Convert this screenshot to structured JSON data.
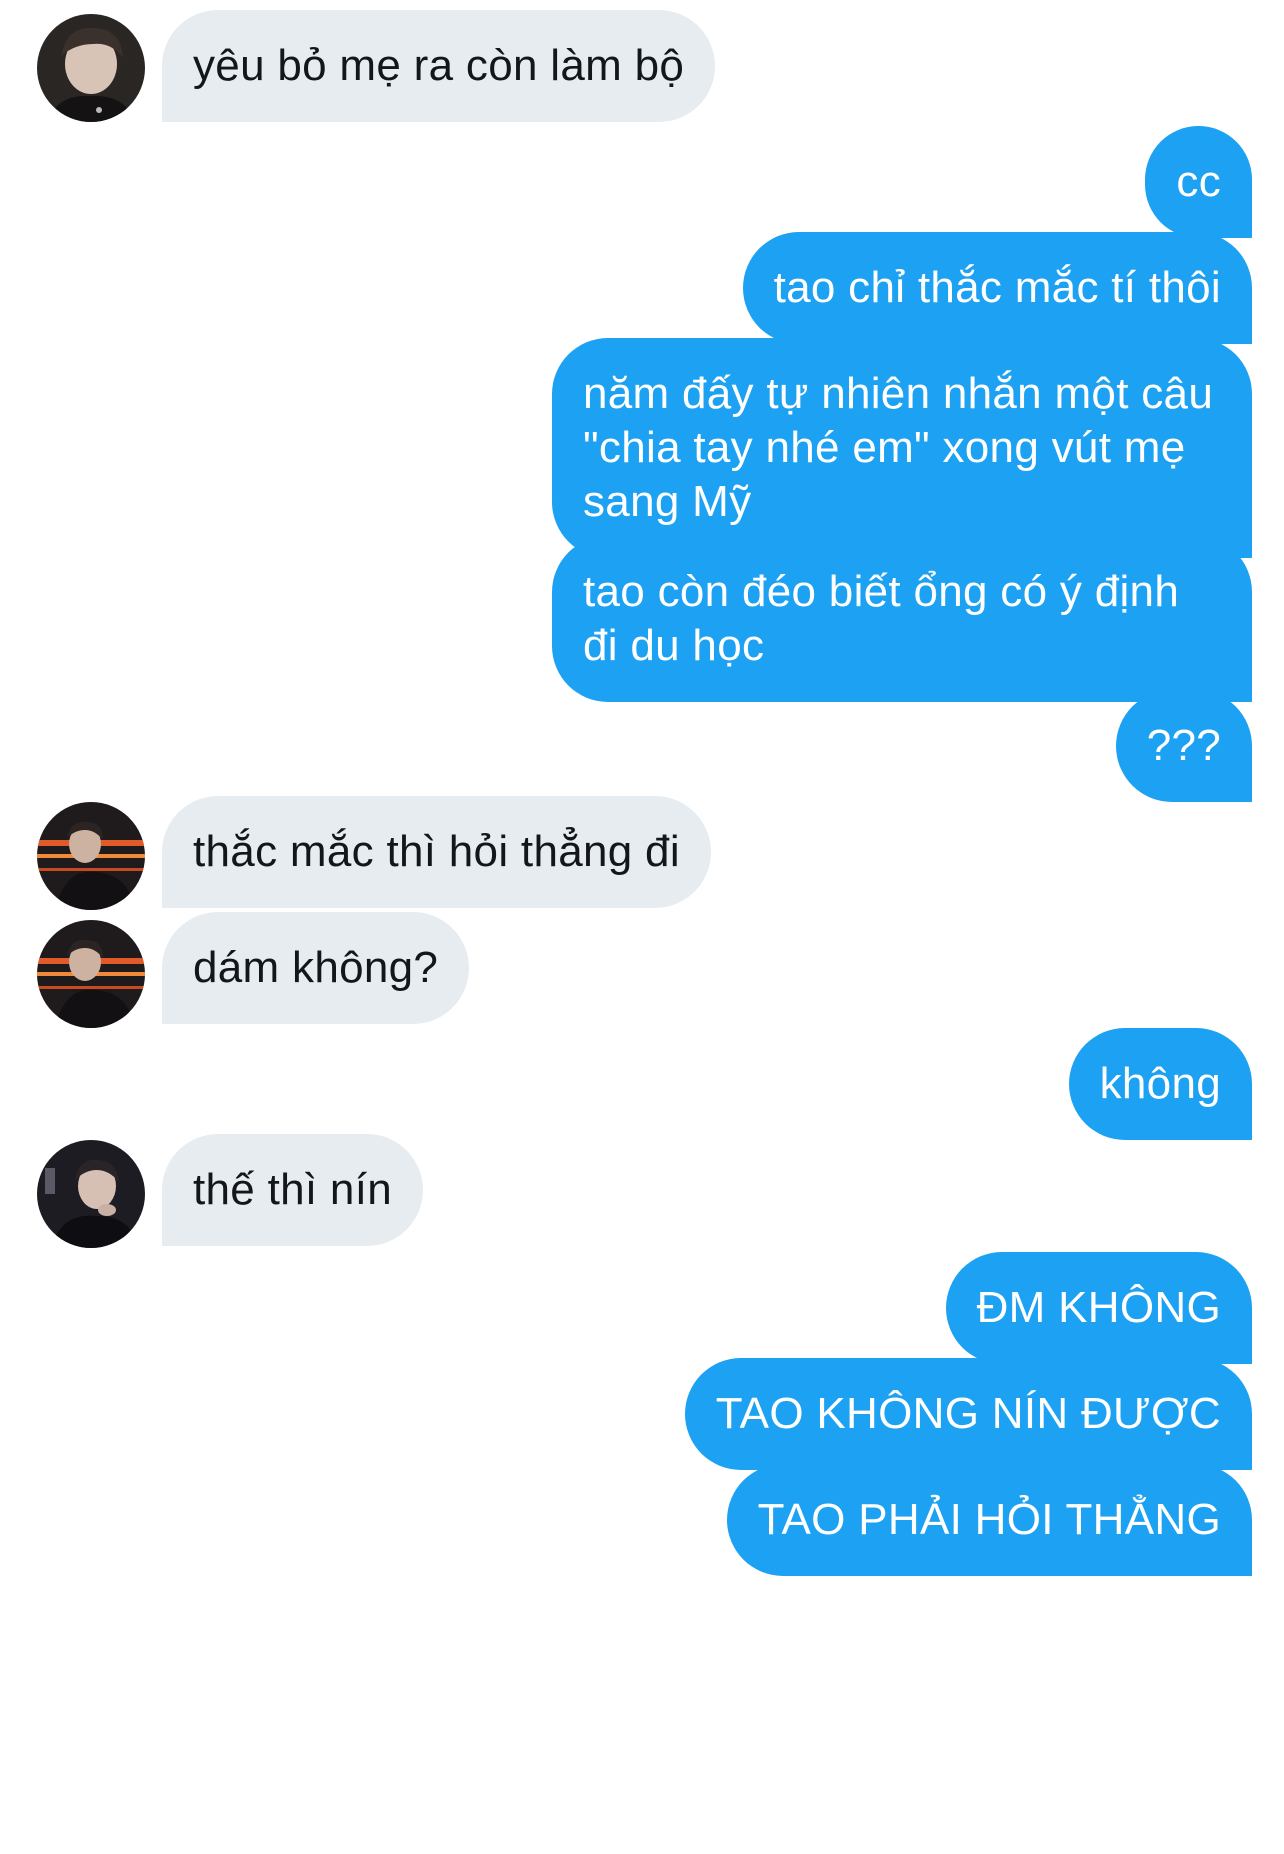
{
  "conversation": {
    "messages": [
      {
        "side": "received",
        "text": "yêu bỏ mẹ ra còn làm bộ"
      },
      {
        "side": "sent",
        "text": "cc"
      },
      {
        "side": "sent",
        "text": "tao chỉ thắc mắc tí thôi"
      },
      {
        "side": "sent",
        "text": "năm đấy tự nhiên nhắn một câu \"chia tay nhé em\" xong vút mẹ sang Mỹ"
      },
      {
        "side": "sent",
        "text": "tao còn đéo biết ổng có ý định đi du học"
      },
      {
        "side": "sent",
        "text": "???"
      },
      {
        "side": "received",
        "text": "thắc mắc thì hỏi thẳng đi"
      },
      {
        "side": "received",
        "text": "dám không?"
      },
      {
        "side": "sent",
        "text": "không"
      },
      {
        "side": "received",
        "text": "thế thì nín"
      },
      {
        "side": "sent",
        "text": "ĐM KHÔNG"
      },
      {
        "side": "sent",
        "text": "TAO KHÔNG NÍN ĐƯỢC"
      },
      {
        "side": "sent",
        "text": "TAO PHẢI HỎI THẲNG"
      }
    ]
  },
  "colors": {
    "received_bubble": "#e6ecf0",
    "sent_bubble": "#1da1f2",
    "received_text": "#14171a",
    "sent_text": "#ffffff"
  },
  "avatars": [
    "user-avatar-photo",
    "user-avatar-photo",
    "user-avatar-photo",
    "user-avatar-photo"
  ]
}
